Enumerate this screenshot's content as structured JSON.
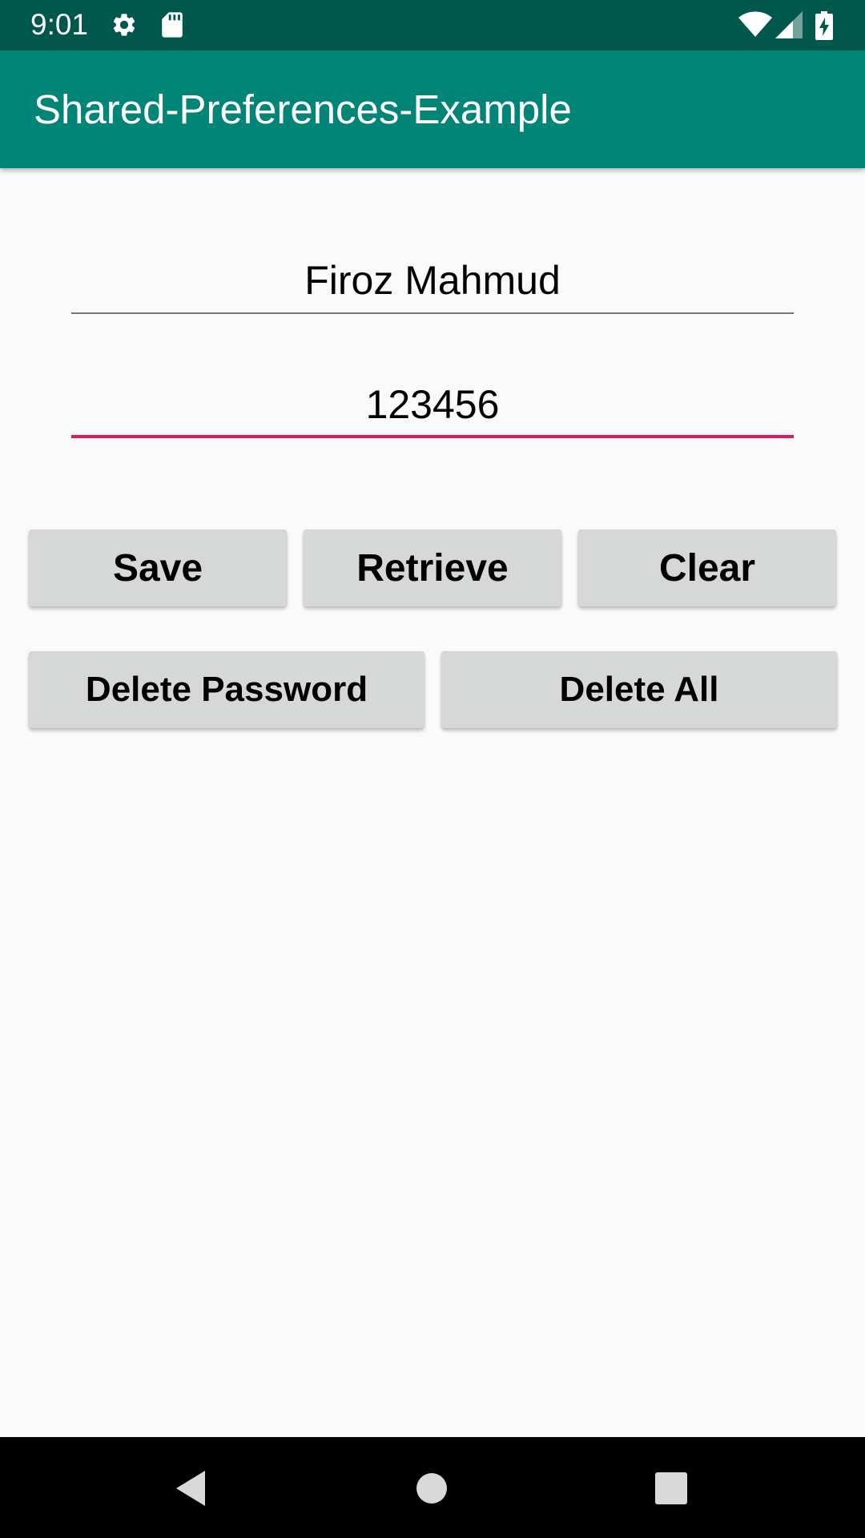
{
  "status_bar": {
    "time": "9:01",
    "icons": [
      "gear-icon",
      "sd-card-icon",
      "wifi-icon",
      "cell-signal-icon",
      "battery-charging-icon"
    ],
    "background": "#00574b"
  },
  "app_bar": {
    "title": "Shared-Preferences-Example",
    "background": "#008577"
  },
  "form": {
    "name_value": "Firoz Mahmud",
    "password_value": "123456",
    "focus_underline_color": "#d81b60"
  },
  "buttons": {
    "save": "Save",
    "retrieve": "Retrieve",
    "clear": "Clear",
    "delete_password": "Delete Password",
    "delete_all": "Delete All",
    "background": "#d6d7d7"
  },
  "nav_bar": {
    "icons": [
      "back-icon",
      "home-icon",
      "recents-icon"
    ]
  }
}
